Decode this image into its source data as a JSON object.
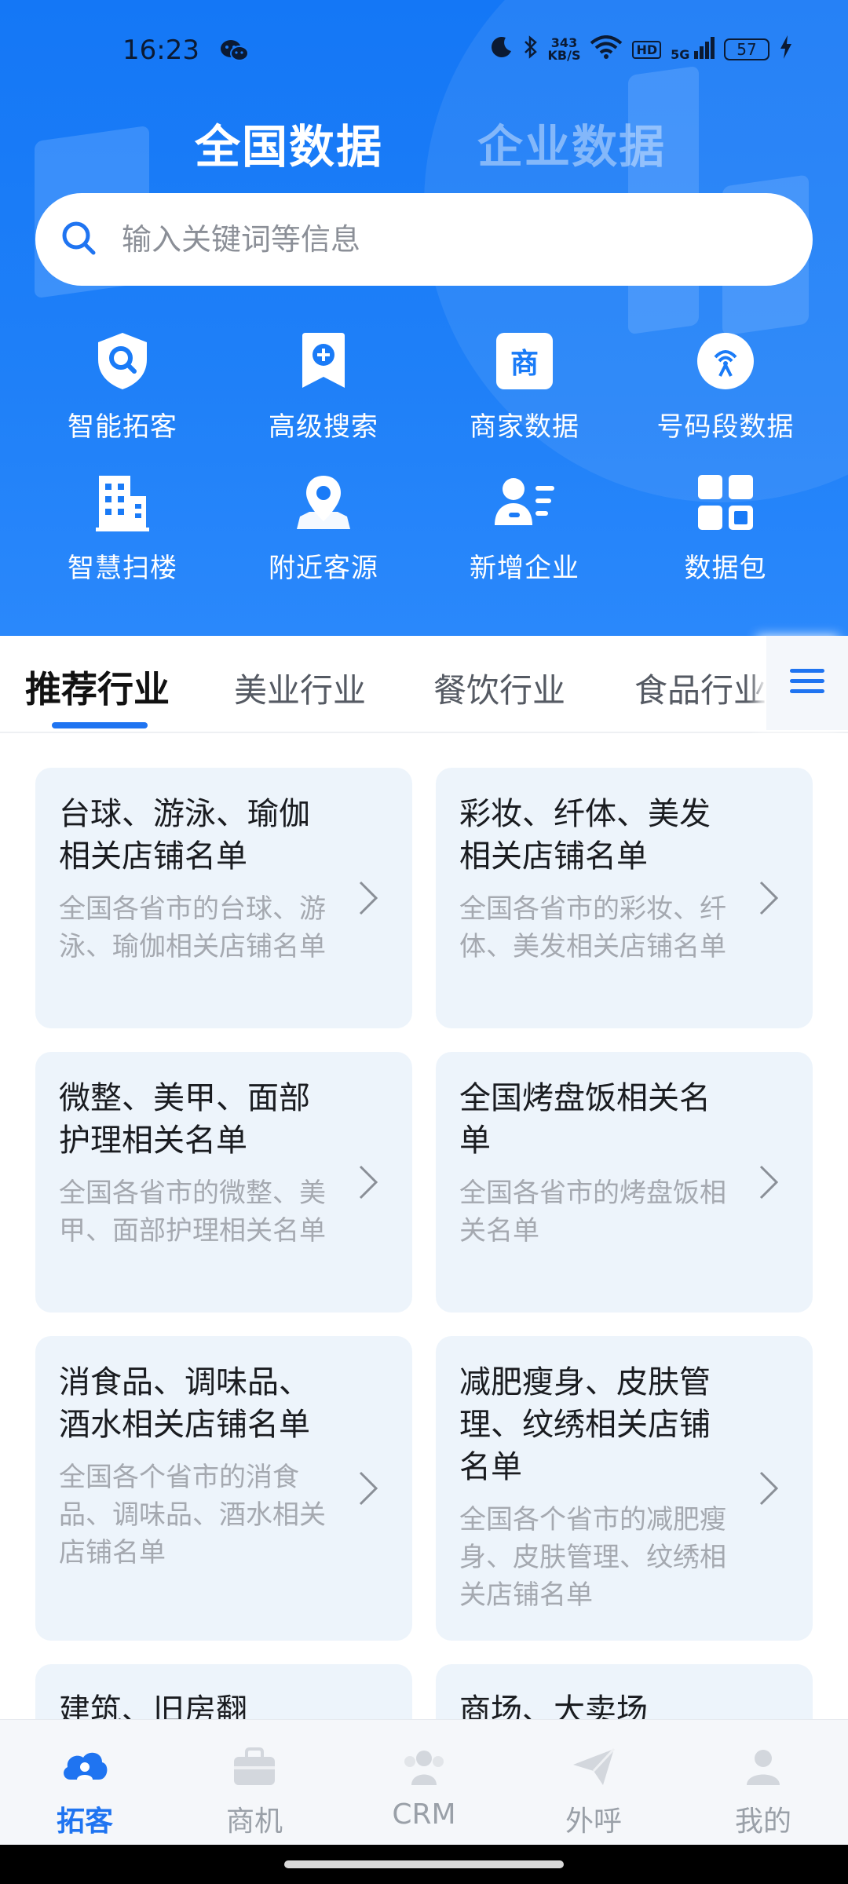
{
  "status_bar": {
    "time": "16:23",
    "net_speed_value": "343",
    "net_speed_unit": "KB/S",
    "hd": "HD",
    "signal": "5G",
    "battery": "57",
    "icons": [
      "wechat-icon",
      "moon-icon",
      "bluetooth-icon",
      "wifi-icon",
      "signal-icon",
      "battery-icon",
      "charging-icon"
    ]
  },
  "header": {
    "tabs": [
      "全国数据",
      "企业数据"
    ],
    "active_tab": 0
  },
  "search": {
    "placeholder": "输入关键词等信息",
    "value": ""
  },
  "features": [
    {
      "label": "智能拓客",
      "icon": "shield-search-icon"
    },
    {
      "label": "高级搜索",
      "icon": "bookmark-plus-icon"
    },
    {
      "label": "商家数据",
      "icon": "shop-badge-icon",
      "badge": "商"
    },
    {
      "label": "号码段数据",
      "icon": "signal-tower-icon"
    },
    {
      "label": "智慧扫楼",
      "icon": "building-icon"
    },
    {
      "label": "附近客源",
      "icon": "location-pin-icon"
    },
    {
      "label": "新增企业",
      "icon": "user-list-icon"
    },
    {
      "label": "数据包",
      "icon": "grid-package-icon"
    }
  ],
  "categories": {
    "items": [
      "推荐行业",
      "美业行业",
      "餐饮行业",
      "食品行业"
    ],
    "active": 0,
    "menu_icon": "menu-icon"
  },
  "cards": [
    {
      "title": "台球、游泳、瑜伽相关店铺名单",
      "desc": "全国各省市的台球、游泳、瑜伽相关店铺名单"
    },
    {
      "title": "彩妆、纤体、美发相关店铺名单",
      "desc": "全国各省市的彩妆、纤体、美发相关店铺名单"
    },
    {
      "title": "微整、美甲、面部护理相关名单",
      "desc": "全国各省市的微整、美甲、面部护理相关名单"
    },
    {
      "title": "全国烤盘饭相关名单",
      "desc": "全国各省市的烤盘饭相关名单"
    },
    {
      "title": "消食品、调味品、酒水相关店铺名单",
      "desc": "全国各个省市的消食品、调味品、酒水相关店铺名单"
    },
    {
      "title": "减肥瘦身、皮肤管理、纹绣相关店铺名单",
      "desc": "全国各个省市的减肥瘦身、皮肤管理、纹绣相关店铺名单"
    },
    {
      "title": "建筑、旧房翻",
      "desc": ""
    },
    {
      "title": "商场、大卖场",
      "desc": ""
    }
  ],
  "bottom_nav": {
    "items": [
      {
        "label": "拓客",
        "icon": "cloud-people-icon"
      },
      {
        "label": "商机",
        "icon": "briefcase-icon"
      },
      {
        "label": "CRM",
        "icon": "team-icon"
      },
      {
        "label": "外呼",
        "icon": "paper-plane-icon"
      },
      {
        "label": "我的",
        "icon": "person-icon"
      }
    ],
    "active": 0
  },
  "colors": {
    "primary": "#1f74f1",
    "hero_bg": "#1a7bf7",
    "card_bg": "#edf4fb",
    "inactive_text": "#9aa0a8"
  }
}
